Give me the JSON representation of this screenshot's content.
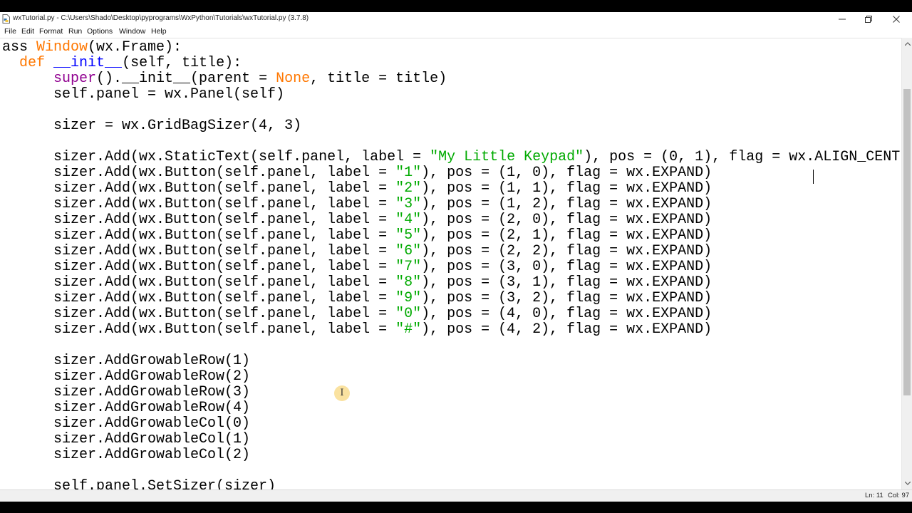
{
  "window": {
    "title": "wxTutorial.py - C:\\Users\\Shado\\Desktop\\pyprograms\\WxPython\\Tutorials\\wxTutorial.py (3.7.8)"
  },
  "menu": [
    "File",
    "Edit",
    "Format",
    "Run",
    "Options",
    "Window",
    "Help"
  ],
  "code": [
    [
      [
        "t",
        "ass "
      ],
      [
        "k",
        "Window"
      ],
      [
        "t",
        "(wx.Frame):"
      ]
    ],
    [
      [
        "t",
        "  "
      ],
      [
        "k",
        "def"
      ],
      [
        "t",
        " "
      ],
      [
        "f",
        "__init__"
      ],
      [
        "t",
        "(self, title):"
      ]
    ],
    [
      [
        "t",
        "      "
      ],
      [
        "b",
        "super"
      ],
      [
        "t",
        "().__init__(parent = "
      ],
      [
        "k",
        "None"
      ],
      [
        "t",
        ", title = title)"
      ]
    ],
    [
      [
        "t",
        "      self.panel = wx.Panel(self)"
      ]
    ],
    [
      [
        "t",
        ""
      ]
    ],
    [
      [
        "t",
        "      sizer = wx.GridBagSizer(4, 3)"
      ]
    ],
    [
      [
        "t",
        ""
      ]
    ],
    [
      [
        "t",
        "      sizer.Add(wx.StaticText(self.panel, label = "
      ],
      [
        "s",
        "\"My Little Keypad\""
      ],
      [
        "t",
        "), pos = (0, 1), flag = wx.ALIGN_CENT"
      ]
    ],
    [
      [
        "t",
        "      sizer.Add(wx.Button(self.panel, label = "
      ],
      [
        "s",
        "\"1\""
      ],
      [
        "t",
        "), pos = (1, 0), flag = wx.EXPAND)"
      ]
    ],
    [
      [
        "t",
        "      sizer.Add(wx.Button(self.panel, label = "
      ],
      [
        "s",
        "\"2\""
      ],
      [
        "t",
        "), pos = (1, 1), flag = wx.EXPAND)"
      ]
    ],
    [
      [
        "t",
        "      sizer.Add(wx.Button(self.panel, label = "
      ],
      [
        "s",
        "\"3\""
      ],
      [
        "t",
        "), pos = (1, 2), flag = wx.EXPAND)"
      ]
    ],
    [
      [
        "t",
        "      sizer.Add(wx.Button(self.panel, label = "
      ],
      [
        "s",
        "\"4\""
      ],
      [
        "t",
        "), pos = (2, 0), flag = wx.EXPAND)"
      ]
    ],
    [
      [
        "t",
        "      sizer.Add(wx.Button(self.panel, label = "
      ],
      [
        "s",
        "\"5\""
      ],
      [
        "t",
        "), pos = (2, 1), flag = wx.EXPAND)"
      ]
    ],
    [
      [
        "t",
        "      sizer.Add(wx.Button(self.panel, label = "
      ],
      [
        "s",
        "\"6\""
      ],
      [
        "t",
        "), pos = (2, 2), flag = wx.EXPAND)"
      ]
    ],
    [
      [
        "t",
        "      sizer.Add(wx.Button(self.panel, label = "
      ],
      [
        "s",
        "\"7\""
      ],
      [
        "t",
        "), pos = (3, 0), flag = wx.EXPAND)"
      ]
    ],
    [
      [
        "t",
        "      sizer.Add(wx.Button(self.panel, label = "
      ],
      [
        "s",
        "\"8\""
      ],
      [
        "t",
        "), pos = (3, 1), flag = wx.EXPAND)"
      ]
    ],
    [
      [
        "t",
        "      sizer.Add(wx.Button(self.panel, label = "
      ],
      [
        "s",
        "\"9\""
      ],
      [
        "t",
        "), pos = (3, 2), flag = wx.EXPAND)"
      ]
    ],
    [
      [
        "t",
        "      sizer.Add(wx.Button(self.panel, label = "
      ],
      [
        "s",
        "\"0\""
      ],
      [
        "t",
        "), pos = (4, 0), flag = wx.EXPAND)"
      ]
    ],
    [
      [
        "t",
        "      sizer.Add(wx.Button(self.panel, label = "
      ],
      [
        "s",
        "\"#\""
      ],
      [
        "t",
        "), pos = (4, 2), flag = wx.EXPAND)"
      ]
    ],
    [
      [
        "t",
        ""
      ]
    ],
    [
      [
        "t",
        "      sizer.AddGrowableRow(1)"
      ]
    ],
    [
      [
        "t",
        "      sizer.AddGrowableRow(2)"
      ]
    ],
    [
      [
        "t",
        "      sizer.AddGrowableRow(3)"
      ]
    ],
    [
      [
        "t",
        "      sizer.AddGrowableRow(4)"
      ]
    ],
    [
      [
        "t",
        "      sizer.AddGrowableCol(0)"
      ]
    ],
    [
      [
        "t",
        "      sizer.AddGrowableCol(1)"
      ]
    ],
    [
      [
        "t",
        "      sizer.AddGrowableCol(2)"
      ]
    ],
    [
      [
        "t",
        ""
      ]
    ],
    [
      [
        "t",
        "      self.panel.SetSizer(sizer)"
      ]
    ]
  ],
  "cursor_glyph": "I",
  "status": {
    "ln": "Ln: 11",
    "col": "Col: 97"
  },
  "colors": {
    "keyword": "#ff7700",
    "builtin": "#900090",
    "definition": "#0000ff",
    "string": "#00aa00"
  }
}
